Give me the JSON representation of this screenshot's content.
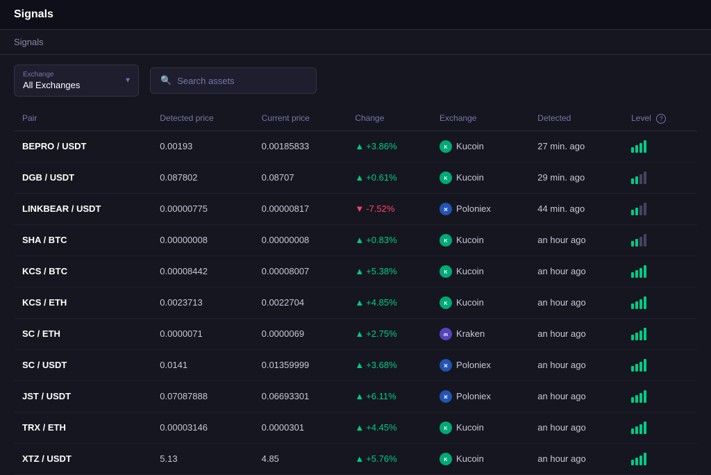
{
  "app": {
    "title": "Signals"
  },
  "breadcrumb": "Signals",
  "toolbar": {
    "exchange_label": "Exchange",
    "exchange_value": "All Exchanges",
    "search_placeholder": "Search assets"
  },
  "table": {
    "columns": [
      {
        "key": "pair",
        "label": "Pair"
      },
      {
        "key": "detected_price",
        "label": "Detected price"
      },
      {
        "key": "current_price",
        "label": "Current price"
      },
      {
        "key": "change",
        "label": "Change"
      },
      {
        "key": "exchange",
        "label": "Exchange"
      },
      {
        "key": "detected",
        "label": "Detected"
      },
      {
        "key": "level",
        "label": "Level"
      }
    ],
    "rows": [
      {
        "pair": "BEPRO / USDT",
        "detected_price": "0.00193",
        "current_price": "0.00185833",
        "change": "+3.86%",
        "change_dir": "up",
        "exchange": "Kucoin",
        "exchange_type": "kucoin",
        "detected": "27 min. ago",
        "level": 4
      },
      {
        "pair": "DGB / USDT",
        "detected_price": "0.087802",
        "current_price": "0.08707",
        "change": "+0.61%",
        "change_dir": "up",
        "exchange": "Kucoin",
        "exchange_type": "kucoin",
        "detected": "29 min. ago",
        "level": 2
      },
      {
        "pair": "LINKBEAR / USDT",
        "detected_price": "0.00000775",
        "current_price": "0.00000817",
        "change": "-7.52%",
        "change_dir": "down",
        "exchange": "Poloniex",
        "exchange_type": "poloniex",
        "detected": "44 min. ago",
        "level": 2
      },
      {
        "pair": "SHA / BTC",
        "detected_price": "0.00000008",
        "current_price": "0.00000008",
        "change": "+0.83%",
        "change_dir": "up",
        "exchange": "Kucoin",
        "exchange_type": "kucoin",
        "detected": "an hour ago",
        "level": 2
      },
      {
        "pair": "KCS / BTC",
        "detected_price": "0.00008442",
        "current_price": "0.00008007",
        "change": "+5.38%",
        "change_dir": "up",
        "exchange": "Kucoin",
        "exchange_type": "kucoin",
        "detected": "an hour ago",
        "level": 4
      },
      {
        "pair": "KCS / ETH",
        "detected_price": "0.0023713",
        "current_price": "0.0022704",
        "change": "+4.85%",
        "change_dir": "up",
        "exchange": "Kucoin",
        "exchange_type": "kucoin",
        "detected": "an hour ago",
        "level": 4
      },
      {
        "pair": "SC / ETH",
        "detected_price": "0.0000071",
        "current_price": "0.0000069",
        "change": "+2.75%",
        "change_dir": "up",
        "exchange": "Kraken",
        "exchange_type": "kraken",
        "detected": "an hour ago",
        "level": 4
      },
      {
        "pair": "SC / USDT",
        "detected_price": "0.0141",
        "current_price": "0.01359999",
        "change": "+3.68%",
        "change_dir": "up",
        "exchange": "Poloniex",
        "exchange_type": "poloniex",
        "detected": "an hour ago",
        "level": 4
      },
      {
        "pair": "JST / USDT",
        "detected_price": "0.07087888",
        "current_price": "0.06693301",
        "change": "+6.11%",
        "change_dir": "up",
        "exchange": "Poloniex",
        "exchange_type": "poloniex",
        "detected": "an hour ago",
        "level": 4
      },
      {
        "pair": "TRX / ETH",
        "detected_price": "0.00003146",
        "current_price": "0.0000301",
        "change": "+4.45%",
        "change_dir": "up",
        "exchange": "Kucoin",
        "exchange_type": "kucoin",
        "detected": "an hour ago",
        "level": 4
      },
      {
        "pair": "XTZ / USDT",
        "detected_price": "5.13",
        "current_price": "4.85",
        "change": "+5.76%",
        "change_dir": "up",
        "exchange": "Kucoin",
        "exchange_type": "kucoin",
        "detected": "an hour ago",
        "level": 4
      }
    ]
  },
  "icons": {
    "kucoin_letter": "K",
    "poloniex_letter": "P",
    "kraken_letter": "m"
  },
  "colors": {
    "up": "#00cc88",
    "down": "#ff4466",
    "bg": "#161620",
    "header_bg": "#0f0f1a"
  }
}
